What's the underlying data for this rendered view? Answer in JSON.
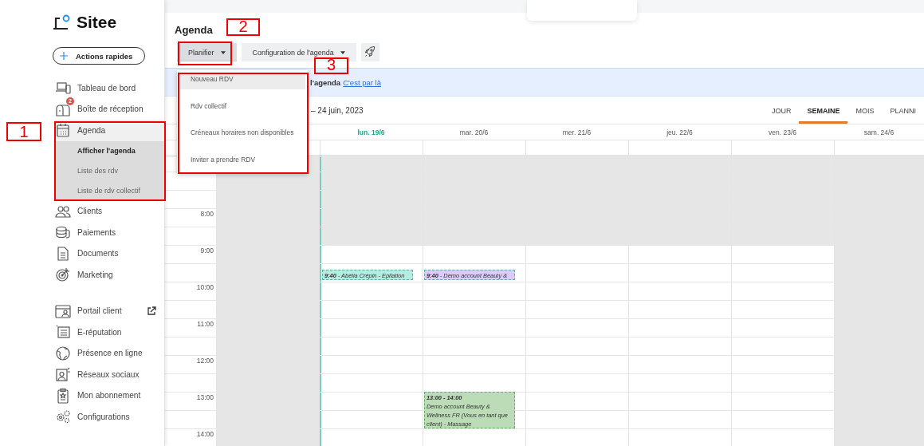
{
  "sidebar": {
    "logo": "Sitee",
    "quick_action": "Actions rapides",
    "items": [
      {
        "label": "Tableau de bord"
      },
      {
        "label": "Boîte de réception",
        "badge": "2"
      },
      {
        "label": "Agenda",
        "expanded": true,
        "children": [
          {
            "label": "Afficher l'agenda",
            "selected": true
          },
          {
            "label": "Liste des rdv",
            "selected": false
          },
          {
            "label": "Liste de rdv collectif",
            "selected": false
          }
        ]
      },
      {
        "label": "Clients"
      },
      {
        "label": "Paiements"
      },
      {
        "label": "Documents"
      },
      {
        "label": "Marketing"
      }
    ],
    "tools": [
      {
        "label": "Portail client",
        "external": true
      },
      {
        "label": "E-réputation"
      },
      {
        "label": "Présence en ligne"
      },
      {
        "label": "Réseaux sociaux"
      },
      {
        "label": "Mon abonnement"
      },
      {
        "label": "Configurations"
      }
    ]
  },
  "page": {
    "title": "Agenda",
    "toolbar": [
      {
        "label": "Planifier",
        "open": true
      },
      {
        "label": "Configuration de l'agenda",
        "open": false
      }
    ],
    "menu": [
      {
        "label": "Nouveau RDV",
        "selected": true
      },
      {
        "label": "Rdv collectif",
        "selected": false
      },
      {
        "label": "Créneaux horaires non disponibles",
        "selected": false
      },
      {
        "label": "Inviter a prendre RDV",
        "selected": false
      }
    ],
    "banner": {
      "text": "**l'agenda**",
      "link": "C'est par là"
    }
  },
  "calendar": {
    "date_range": "– 24 juin, 2023",
    "views": [
      {
        "label": "JOUR",
        "selected": false
      },
      {
        "label": "SEMAINE",
        "selected": true
      },
      {
        "label": "MOIS",
        "selected": false
      },
      {
        "label": "PLANNI",
        "selected": false
      }
    ],
    "days": [
      {
        "kind": "closed",
        "today": false
      },
      {
        "label": "lun. 19/6",
        "today": true,
        "kind": "workday",
        "events": [
          {
            "time": "9:40",
            "title": "- Abélia Crépin - Epilation",
            "color": "#b3ece0"
          }
        ]
      },
      {
        "label": "mar. 20/6",
        "today": false,
        "kind": "workday",
        "events": [
          {
            "time": "9:40",
            "title": "- Demo account Beauty &",
            "color": "#dccbf8"
          },
          {
            "time": "13:00 - 14:00",
            "title": "Demo account Beauty & Wellness FR (Vous en tant que client) - Massage",
            "color": "#bcdcb8"
          }
        ]
      },
      {
        "label": "mer. 21/6",
        "today": false,
        "kind": "workday"
      },
      {
        "label": "jeu. 22/6",
        "today": false,
        "kind": "workday"
      },
      {
        "label": "ven. 23/6",
        "today": false,
        "kind": "workday"
      },
      {
        "label": "sam. 24/6",
        "today": false,
        "kind": "closed"
      }
    ],
    "hours": [
      "8:00",
      "9:00",
      "10:00",
      "11:00",
      "12:00",
      "13:00",
      "14:00"
    ]
  },
  "annotations": [
    {
      "label": "1"
    },
    {
      "label": "2"
    },
    {
      "label": "3"
    }
  ]
}
